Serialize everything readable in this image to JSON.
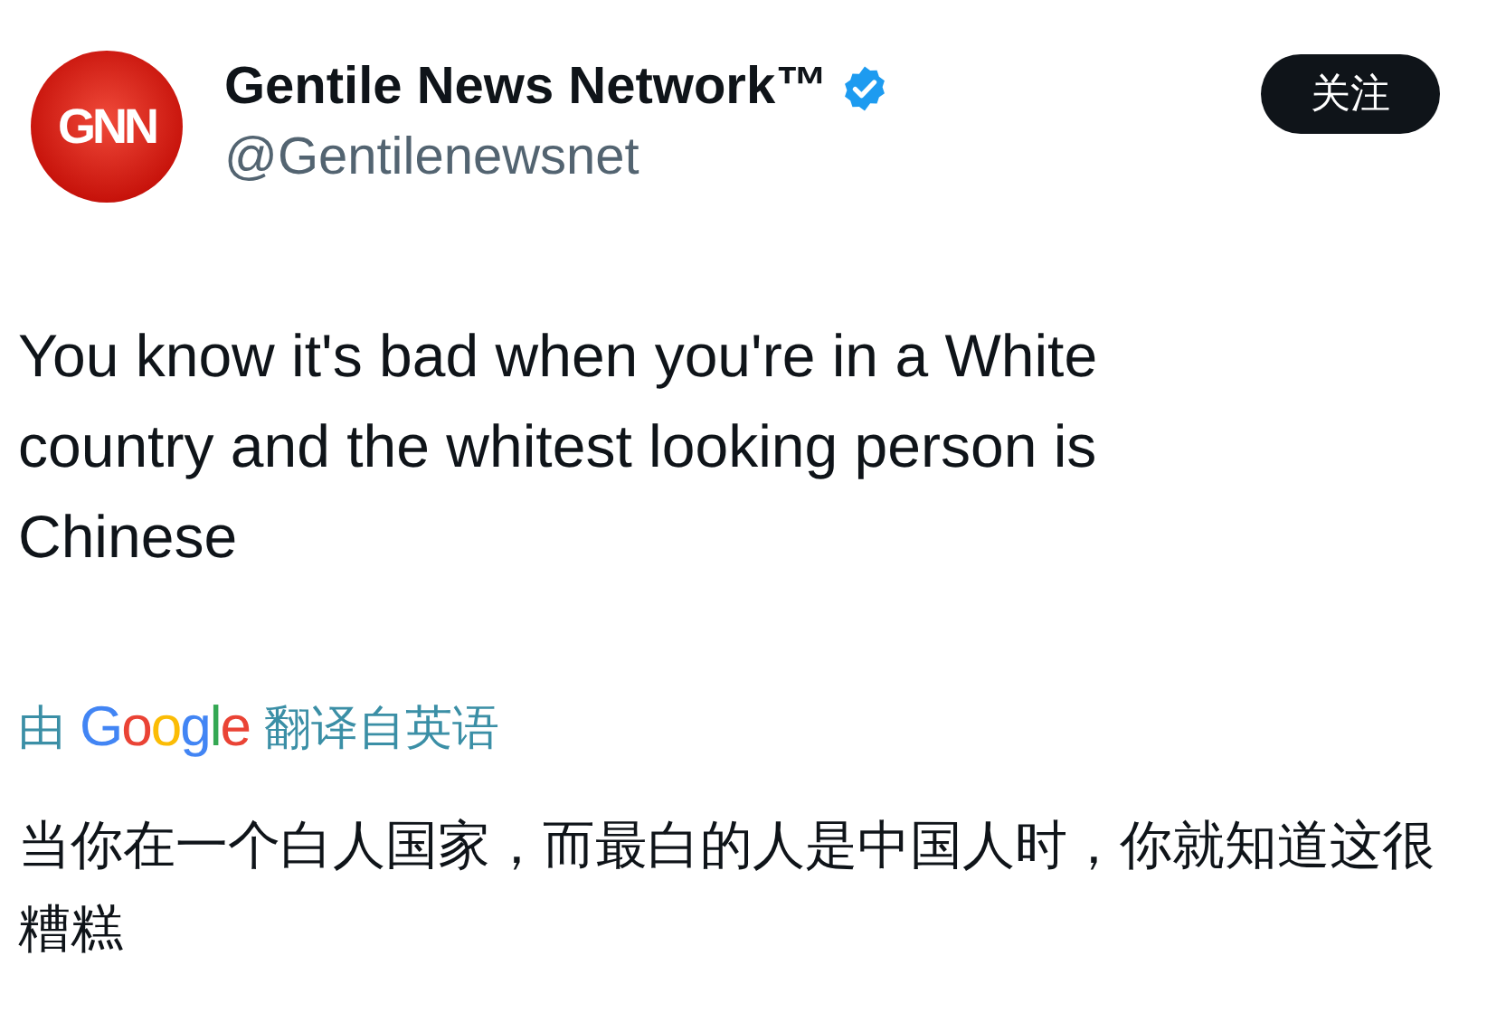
{
  "author": {
    "avatar_text": "GNN",
    "name": "Gentile News Network™",
    "verified": true,
    "handle": "@Gentilenewsnet"
  },
  "follow_button": "关注",
  "tweet_text": "You know it's bad when you're in a White country and the whitest looking person is Chinese",
  "translation": {
    "prefix": "由",
    "logo": "Google",
    "suffix": "翻译自英语"
  },
  "translated_text": "当你在一个白人国家，而最白的人是中国人时，你就知道这很糟糕"
}
